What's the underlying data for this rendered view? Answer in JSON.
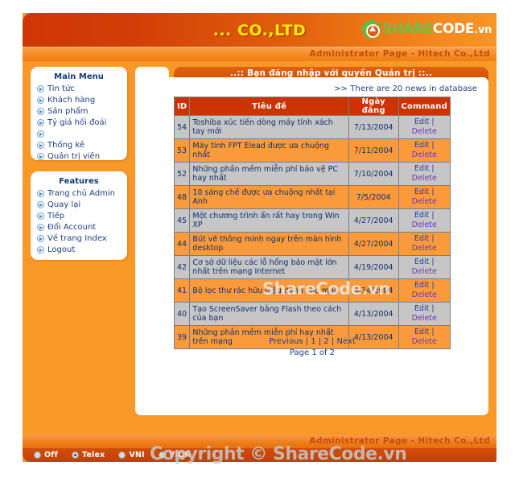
{
  "header": {
    "site_title": "... CO.,LTD",
    "logo": {
      "share": "SHARE",
      "code": "CODE",
      "tld": ".vn"
    },
    "admin_strip": "Administrator Page - Hitech Co.,Ltd"
  },
  "sidebar": {
    "main_menu": {
      "title": "Main Menu",
      "items": [
        {
          "label": "Tin tức"
        },
        {
          "label": "Khách hàng"
        },
        {
          "label": "Sản phẩm"
        },
        {
          "label": "Tỷ giá hối đoái"
        },
        {
          "label": ""
        },
        {
          "label": "Thống kê"
        },
        {
          "label": "Quản trị viên"
        }
      ]
    },
    "features": {
      "title": "Features",
      "items": [
        {
          "label": "Trang chủ Admin"
        },
        {
          "label": "Quay lại"
        },
        {
          "label": "Tiếp"
        },
        {
          "label": "Đổi Account"
        },
        {
          "label": "Về trang Index"
        },
        {
          "label": "Logout"
        }
      ]
    }
  },
  "content": {
    "tab_title": "..:: Bạn đăng nhập với quyền Quản trị ::..",
    "db_note": ">> There are 20 news in database",
    "table": {
      "columns": [
        "ID",
        "Tiêu đề",
        "Ngày đăng",
        "Command"
      ],
      "command_edit": "Edit",
      "command_sep": "|",
      "command_delete": "Delete",
      "rows": [
        {
          "id": "54",
          "title": "Toshiba xúc tiến dòng máy tính xách tay mới",
          "date": "7/13/2004"
        },
        {
          "id": "53",
          "title": "Máy tính FPT Elead được ưa chuộng nhất",
          "date": "7/11/2004"
        },
        {
          "id": "52",
          "title": "Những phần mềm miễn phí bảo vệ PC hay nhất",
          "date": "7/10/2004"
        },
        {
          "id": "48",
          "title": "10 sáng chế được ưa chuộng nhất tại Anh",
          "date": "7/5/2004"
        },
        {
          "id": "45",
          "title": "Một chương trình ẩn rất hay trong Win XP",
          "date": "4/27/2004"
        },
        {
          "id": "44",
          "title": "Bút vẽ thông minh ngay trên màn hình desktop",
          "date": "4/27/2004"
        },
        {
          "id": "42",
          "title": "Cơ sở dữ liệu các lỗ hổng bảo mật lớn nhất trên mạng Internet",
          "date": "4/19/2004"
        },
        {
          "id": "41",
          "title": "Bộ lọc thư rác hữu hiệu dành cho mail",
          "date": "4/14/2004"
        },
        {
          "id": "40",
          "title": "Tạo ScreenSaver bằng Flash theo cách của bạn",
          "date": "4/13/2004"
        },
        {
          "id": "39",
          "title": "Những phần mềm miễn phí hay nhất trên mạng",
          "date": "4/13/2004"
        }
      ]
    },
    "pager": {
      "previous": "Previous",
      "page_1": "1",
      "page_2": "2",
      "next": "Next",
      "separator": "|",
      "status": "Page 1 of 2"
    }
  },
  "footer": {
    "admin_strip": "Administrator Page - Hitech Co.,Ltd",
    "input_methods": [
      {
        "label": "Off",
        "selected": false
      },
      {
        "label": "Telex",
        "selected": true
      },
      {
        "label": "VNI",
        "selected": false
      },
      {
        "label": "VIQR",
        "selected": false
      }
    ]
  },
  "watermarks": {
    "middle": "ShareCode.vn",
    "bottom": "Copyright © ShareCode.vn"
  }
}
